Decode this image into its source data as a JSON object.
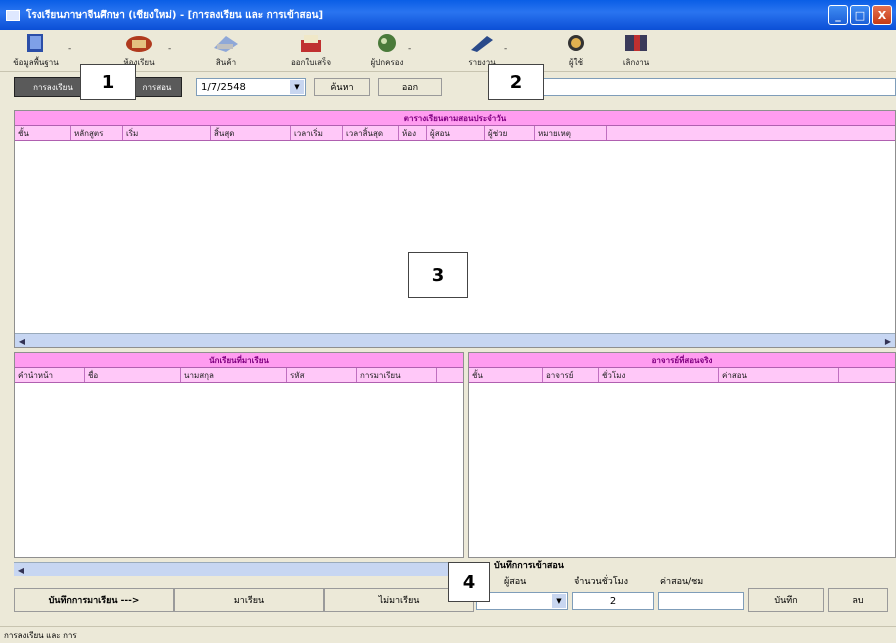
{
  "window": {
    "title": "โรงเรียนภาษาจีนศึกษา (เชียงใหม่) - [การลงเรียน และ การเข้าสอน]",
    "minimize_label": "_",
    "maximize_label": "□",
    "close_label": "X"
  },
  "toolbar": {
    "items": [
      {
        "label": "ข้อมูลพื้นฐาน",
        "icon": "book-icon"
      },
      {
        "label": "ห้องเรียน",
        "icon": "classroom-icon"
      },
      {
        "label": "สินค้า",
        "icon": "goods-icon"
      },
      {
        "label": "ออกใบเสร็จ",
        "icon": "receipt-icon"
      },
      {
        "label": "ผู้ปกครอง",
        "icon": "guardian-icon"
      },
      {
        "label": "รายงาน",
        "icon": "report-icon"
      },
      {
        "label": "ผู้ใช้",
        "icon": "user-icon"
      },
      {
        "label": "เลิกงาน",
        "icon": "exit-icon"
      }
    ],
    "dropdown_glyph": "-"
  },
  "filter": {
    "tab_schedule": "การลงเรียน",
    "tab_teaching": "การสอน",
    "date_value": "1/7/2548",
    "search_label": "ค้นหา",
    "clear_label": "ออก"
  },
  "schedule_grid": {
    "caption": "ตารางเรียนตามสอนประจำวัน",
    "columns": [
      "ชั้น",
      "หลักสูตร",
      "เริ่ม",
      "สิ้นสุด",
      "เวลาเริ่ม",
      "เวลาสิ้นสุด",
      "ห้อง",
      "ผู้สอน",
      "ผู้ช่วย",
      "หมายเหตุ"
    ]
  },
  "students_grid": {
    "caption": "นักเรียนที่มาเรียน",
    "columns": [
      "คำนำหน้า",
      "ชื่อ",
      "นามสกุล",
      "รหัส",
      "การมาเรียน"
    ]
  },
  "teachers_grid": {
    "caption": "อาจารย์ที่สอนจริง",
    "columns": [
      "ชั้น",
      "อาจารย์",
      "ชั่วโมง",
      "ค่าสอน"
    ]
  },
  "bottom": {
    "record_label": "บันทึกการมาเรียน --->",
    "present_label": "มาเรียน",
    "absent_label": "ไม่มาเรียน",
    "teaching_section_title": "บันทึกการเข้าสอน",
    "teacher_label": "ผู้สอน",
    "hours_label": "จำนวนชั่วโมง",
    "rate_label": "ค่าสอน/ชม",
    "hours_value": "2",
    "save_label": "บันทึก",
    "delete_label": "ลบ"
  },
  "status": {
    "text": "การลงเรียน และ การ"
  },
  "callouts": [
    "1",
    "2",
    "3",
    "4"
  ]
}
